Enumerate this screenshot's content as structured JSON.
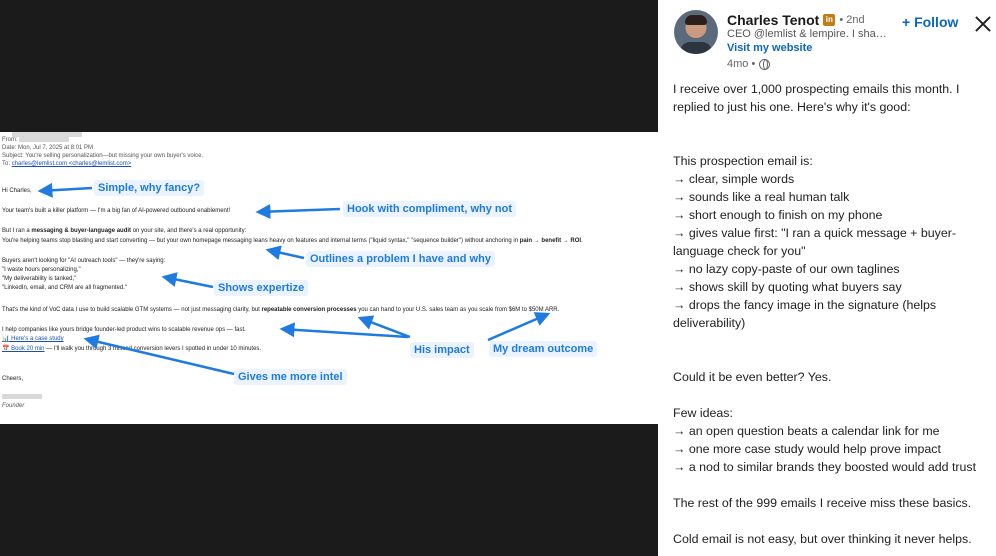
{
  "email": {
    "from_label": "From:",
    "date_line": "Date: Mon, Jul 7, 2025 at 8:01 PM",
    "subject_line": "Subject: You're selling personalization—but missing your own buyer's voice.",
    "to_label": "To:",
    "to_addr": "charles@lemlist.com <charles@lemlist.com>",
    "greeting": "Hi Charles,",
    "line1": "Your team's built a killer platform — I'm a big fan of AI-powered outbound enablement!",
    "line2a": "But I ran a ",
    "line2b": "messaging & buyer-language audit",
    "line2c": " on your site, and there's a real opportunity:",
    "line3a": "You're helping teams stop blasting and start converting — but your own homepage messaging leans heavy on features and internal terms (\"liquid syntax,\" \"sequence builder\") without anchoring in ",
    "line3b": "pain → benefit → ROI",
    "line3c": ".",
    "line4": "Buyers aren't looking for \"AI outreach tools\" — they're saying:",
    "quote1": "\"I waste hours personalizing,\"",
    "quote2": "\"My deliverability is tanked,\"",
    "quote3": "\"LinkedIn, email, and CRM are all fragmented.\"",
    "line5a": "That's the kind of VoC data I use to build scalable GTM systems — not just messaging clarity, but ",
    "line5b": "repeatable conversion processes",
    "line5c": " you can hand to your U.S. sales team as you scale from $6M to $50M ARR.",
    "line6": "I help companies like yours bridge founder-led product wins to scalable revenue ops — fast.",
    "case_study": "📊 Here's a case study",
    "book_link": "📅 Book 20 min",
    "book_rest": " — I'll walk you through 3 missed conversion levers I spotted in under 10 minutes.",
    "signoff": "Cheers,",
    "title": "Founder"
  },
  "callouts": {
    "c1": "Simple, why fancy?",
    "c2": "Hook with compliment, why not",
    "c3": "Outlines a problem I have and why",
    "c4": "Shows expertize",
    "c5": "His impact",
    "c6": "My dream outcome",
    "c7": "Gives me more intel"
  },
  "author": {
    "name": "Charles Tenot",
    "badge": "in",
    "degree": "• 2nd",
    "headline": "CEO @lemlist & lempire. I share ...",
    "website": "Visit my website",
    "time": "4mo •"
  },
  "actions": {
    "follow": "+ Follow"
  },
  "post": {
    "p1": "I receive over 1,000 prospecting emails this month. I replied to just his one. Here's why it's good:",
    "p2": "This prospection email is:",
    "list1": [
      "→ clear, simple words",
      "→ sounds like a real human talk",
      "→ short enough to finish on my phone",
      "→ gives value first: \"I ran a quick message + buyer-language check for you\"",
      "→ no lazy copy-paste of our own taglines",
      "→ shows skill by quoting what buyers say",
      "→ drops the fancy image in the signature (helps deliverability)"
    ],
    "p3": "Could it be even better? Yes.",
    "p4": "Few ideas:",
    "list2": [
      "→ an open question beats a calendar link for me",
      "→ one more case study would help prove impact",
      "→ a nod to similar brands they boosted would add trust"
    ],
    "p5": "The rest of the 999 emails I receive miss these basics.",
    "p6": "Cold email is not easy, but over thinking it never helps."
  },
  "colors": {
    "callout_blue": "#1f7be0",
    "linkedin_blue": "#0a66c2",
    "premium_gold": "#c37d16"
  }
}
